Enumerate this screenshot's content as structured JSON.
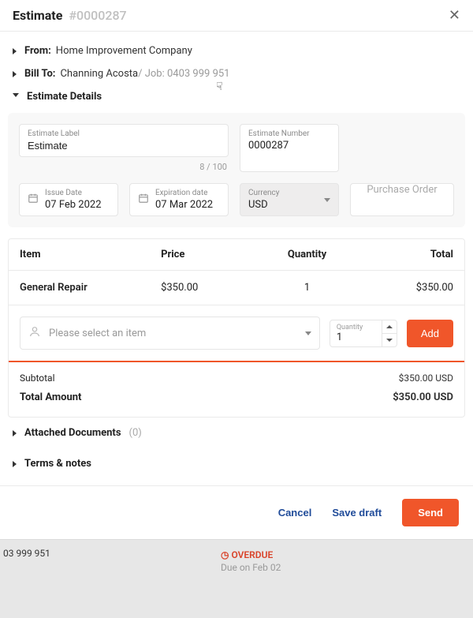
{
  "header": {
    "title": "Estimate",
    "number": "#0000287"
  },
  "from": {
    "label": "From:",
    "value": "Home Improvement Company"
  },
  "billTo": {
    "label": "Bill To:",
    "name": "Channing Acosta",
    "job": " / Job: 0403 999 951"
  },
  "detailsTitle": "Estimate Details",
  "fields": {
    "estimateLabel": {
      "label": "Estimate Label",
      "value": "Estimate",
      "counter": "8 / 100"
    },
    "estimateNumber": {
      "label": "Estimate Number",
      "value": "0000287"
    },
    "issueDate": {
      "label": "Issue Date",
      "value": "07 Feb 2022"
    },
    "expDate": {
      "label": "Expiration date",
      "value": "07 Mar 2022"
    },
    "currency": {
      "label": "Currency",
      "value": "USD"
    },
    "poPlaceholder": "Purchase Order"
  },
  "table": {
    "headers": {
      "item": "Item",
      "price": "Price",
      "qty": "Quantity",
      "total": "Total"
    },
    "rows": [
      {
        "item": "General Repair",
        "price": "$350.00",
        "qty": "1",
        "total": "$350.00"
      }
    ],
    "addRow": {
      "placeholder": "Please select an item",
      "qtyLabel": "Quantity",
      "qtyValue": "1",
      "addLabel": "Add"
    }
  },
  "totals": {
    "subtotal": {
      "label": "Subtotal",
      "value": "$350.00 USD"
    },
    "total": {
      "label": "Total Amount",
      "value": "$350.00 USD"
    }
  },
  "attached": {
    "label": "Attached Documents",
    "count": "(0)"
  },
  "terms": {
    "label": "Terms & notes"
  },
  "actions": {
    "cancel": "Cancel",
    "draft": "Save draft",
    "send": "Send"
  },
  "behind": {
    "phone": "03 999 951",
    "overdue": "OVERDUE",
    "due": "Due on Feb 02"
  }
}
